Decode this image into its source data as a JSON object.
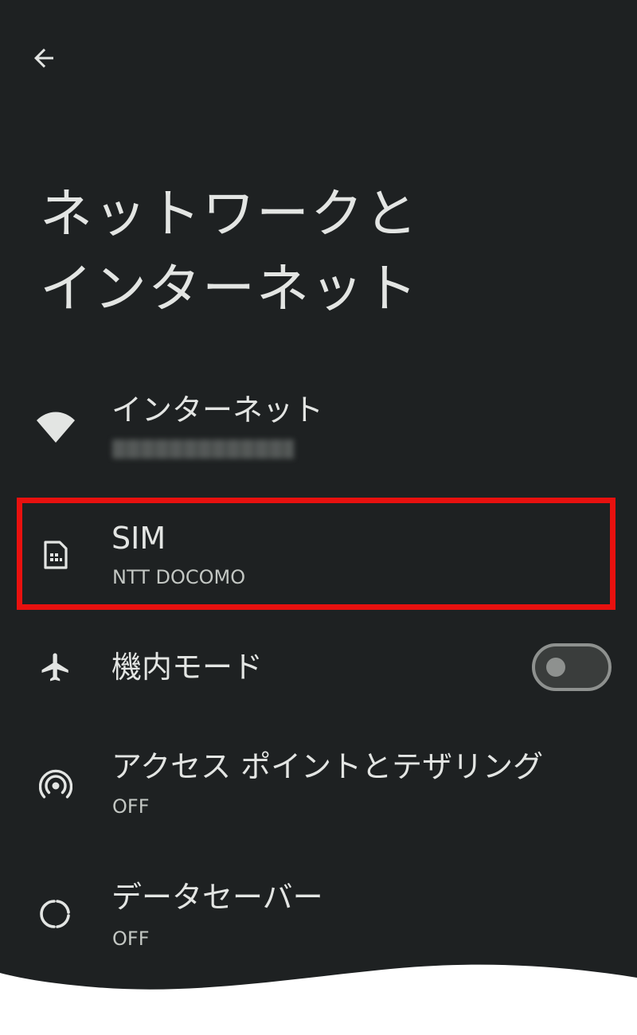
{
  "colors": {
    "background": "#1e2122",
    "text_primary": "#e3e5e3",
    "text_secondary": "#c3c7c3",
    "highlight": "#e8110f",
    "toggle_off": "#8e918f"
  },
  "header": {
    "back_icon": "arrow-left-icon",
    "title_lines": [
      "ネットワークと",
      "インターネット"
    ]
  },
  "items": [
    {
      "icon": "wifi-icon",
      "title": "インターネット",
      "summary": ""
    },
    {
      "icon": "sim-card-icon",
      "title": "SIM",
      "summary": "NTT DOCOMO",
      "highlighted": true
    },
    {
      "icon": "airplane-icon",
      "title": "機内モード",
      "toggle": {
        "state": "off"
      }
    },
    {
      "icon": "hotspot-icon",
      "title": "アクセス ポイントとテザリング",
      "summary": "OFF"
    },
    {
      "icon": "data-saver-icon",
      "title": "データセーバー",
      "summary": "OFF"
    }
  ]
}
